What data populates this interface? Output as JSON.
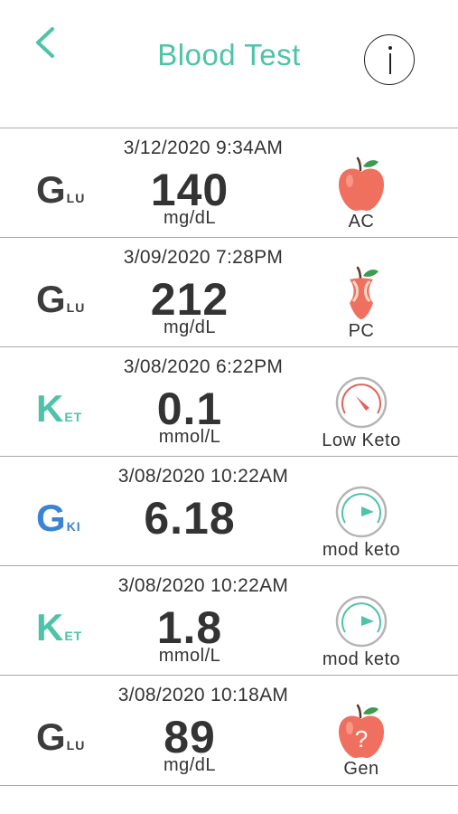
{
  "header": {
    "title": "Blood Test"
  },
  "colors": {
    "accent": "#4ec3a8",
    "glu": "#3c3c3c",
    "ket": "#4ec3a8",
    "gki": "#3b83d4",
    "apple": "#f07060",
    "keto_low": "#e2625a",
    "keto_mod": "#4ec3a8"
  },
  "readings": [
    {
      "date": "3/12/2020 9:34AM",
      "type_big": "G",
      "type_small": "LU",
      "value": "140",
      "unit": "mg/dL",
      "icon": "apple-icon",
      "tag": "AC"
    },
    {
      "date": "3/09/2020 7:28PM",
      "type_big": "G",
      "type_small": "LU",
      "value": "212",
      "unit": "mg/dL",
      "icon": "apple-core-icon",
      "tag": "PC"
    },
    {
      "date": "3/08/2020 6:22PM",
      "type_big": "K",
      "type_small": "ET",
      "value": "0.1",
      "unit": "mmol/L",
      "icon": "gauge-low-icon",
      "tag": "Low Keto"
    },
    {
      "date": "3/08/2020 10:22AM",
      "type_big": "G",
      "type_small": "KI",
      "value": "6.18",
      "unit": "",
      "icon": "gauge-mod-icon",
      "tag": "mod keto"
    },
    {
      "date": "3/08/2020 10:22AM",
      "type_big": "K",
      "type_small": "ET",
      "value": "1.8",
      "unit": "mmol/L",
      "icon": "gauge-mod-icon",
      "tag": "mod keto"
    },
    {
      "date": "3/08/2020 10:18AM",
      "type_big": "G",
      "type_small": "LU",
      "value": "89",
      "unit": "mg/dL",
      "icon": "apple-question-icon",
      "tag": "Gen"
    }
  ]
}
